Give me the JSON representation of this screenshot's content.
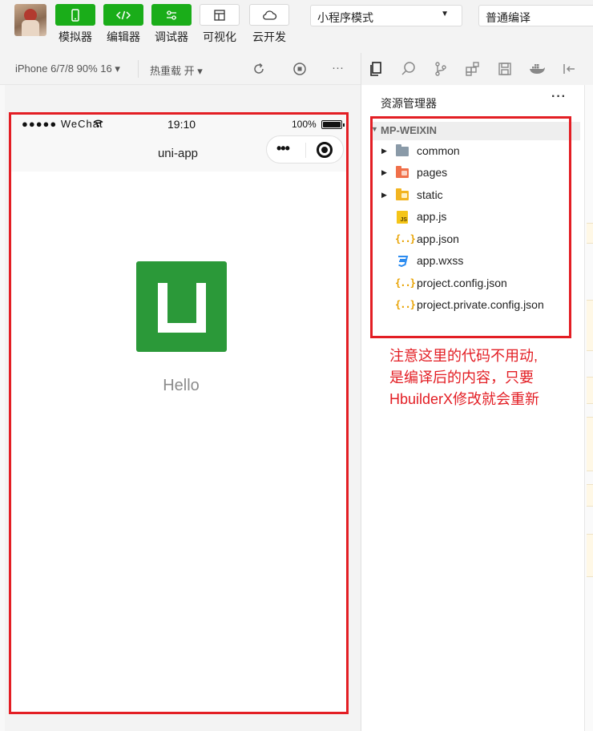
{
  "toolbar": {
    "buttons": [
      {
        "label": "模拟器",
        "icon": "phone-icon"
      },
      {
        "label": "编辑器",
        "icon": "code-icon"
      },
      {
        "label": "调试器",
        "icon": "sliders-icon"
      },
      {
        "label": "可视化",
        "icon": "layout-icon"
      },
      {
        "label": "云开发",
        "icon": "cloud-icon"
      }
    ],
    "mode_select": "小程序模式",
    "compile_select": "普通编译"
  },
  "simulator_bar": {
    "device": "iPhone 6/7/8 90% 16 ▾",
    "hot_reload": "热重载 开 ▾",
    "more": "···"
  },
  "phone": {
    "carrier": "●●●●● WeChat",
    "time": "19:10",
    "battery": "100%",
    "nav_title": "uni-app",
    "content_text": "Hello"
  },
  "explorer": {
    "title": "资源管理器",
    "more": "···",
    "project": "MP-WEIXIN",
    "items": [
      {
        "name": "common",
        "type": "folder",
        "expandable": true
      },
      {
        "name": "pages",
        "type": "folder",
        "expandable": true
      },
      {
        "name": "static",
        "type": "folder",
        "expandable": true
      },
      {
        "name": "app.js",
        "type": "js",
        "expandable": false
      },
      {
        "name": "app.json",
        "type": "json",
        "expandable": false
      },
      {
        "name": "app.wxss",
        "type": "css",
        "expandable": false
      },
      {
        "name": "project.config.json",
        "type": "json",
        "expandable": false
      },
      {
        "name": "project.private.config.json",
        "type": "json",
        "expandable": false
      }
    ]
  },
  "annotation": {
    "lines": [
      "注意这里的代码不用动,",
      "是编译后的内容，只要",
      "HbuilderX修改就会重新"
    ]
  },
  "colors": {
    "green": "#1aad19",
    "annotation_red": "#e31e24",
    "logo_green": "#2b9939"
  }
}
